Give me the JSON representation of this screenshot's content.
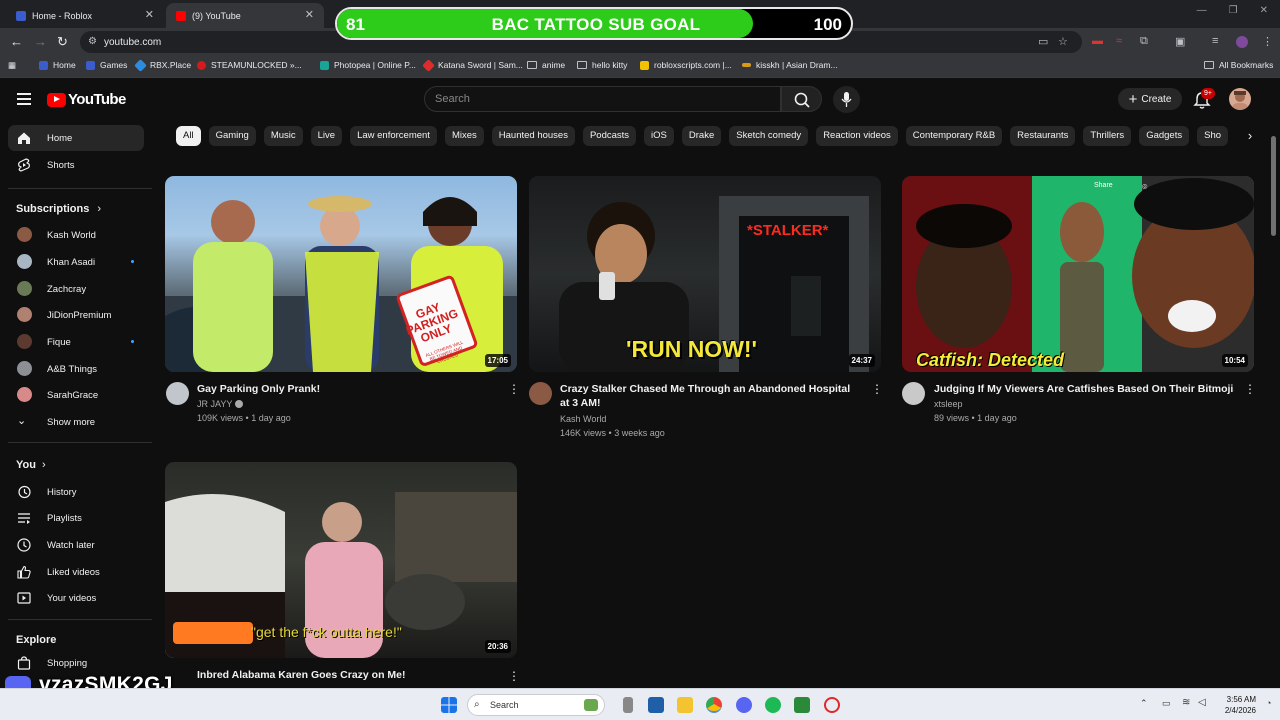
{
  "browser": {
    "tabs": [
      {
        "title": "Home - Roblox"
      },
      {
        "title": "(9) YouTube"
      }
    ],
    "url": "youtube.com",
    "bookmarks": [
      "Home",
      "Games",
      "RBX.Place",
      "STEAMUNLOCKED »...",
      "Photopea | Online P...",
      "Katana Sword | Sam...",
      "anime",
      "hello kitty",
      "robloxscripts.com |...",
      "kisskh | Asian Dram..."
    ],
    "all_bookmarks": "All Bookmarks"
  },
  "subgoal": {
    "current": "81",
    "title": "BAC TATTOO SUB GOAL",
    "goal": "100",
    "progress": 0.81
  },
  "youtube": {
    "logo_text": "YouTube",
    "search_placeholder": "Search",
    "create_label": "Create",
    "notif_badge": "9+",
    "chips": [
      "All",
      "Gaming",
      "Music",
      "Live",
      "Law enforcement",
      "Mixes",
      "Haunted houses",
      "Podcasts",
      "iOS",
      "Drake",
      "Sketch comedy",
      "Reaction videos",
      "Contemporary R&B",
      "Restaurants",
      "Thrillers",
      "Gadgets",
      "Sho"
    ],
    "sidebar": {
      "home": "Home",
      "shorts": "Shorts",
      "subscriptions_head": "Subscriptions",
      "subscriptions": [
        {
          "name": "Kash World",
          "dot": false
        },
        {
          "name": "Khan Asadi",
          "dot": true
        },
        {
          "name": "Zachcray",
          "dot": false
        },
        {
          "name": "JiDionPremium",
          "dot": false
        },
        {
          "name": "Fique",
          "dot": true
        },
        {
          "name": "A&B Things",
          "dot": false
        },
        {
          "name": "SarahGrace",
          "dot": false
        }
      ],
      "show_more": "Show more",
      "you_head": "You",
      "you_items": [
        "History",
        "Playlists",
        "Watch later",
        "Liked videos",
        "Your videos"
      ],
      "explore_head": "Explore",
      "explore_items": [
        "Shopping"
      ]
    },
    "videos": [
      {
        "title": "Gay Parking Only Prank!",
        "channel": "JR JAYY",
        "views": "109K views",
        "age": "1 day ago",
        "duration": "17:05",
        "overlay": "",
        "verified": true
      },
      {
        "title": "Crazy Stalker Chased Me Through an Abandoned Hospital at 3 AM!",
        "channel": "Kash World",
        "views": "146K views",
        "age": "3 weeks ago",
        "duration": "24:37",
        "overlay": "'RUN NOW!'",
        "overlay2": "*STALKER*",
        "verified": false
      },
      {
        "title": "Judging If My Viewers Are Catfishes Based On Their Bitmojis..",
        "channel": "xtsleep",
        "views": "89 views",
        "age": "1 day ago",
        "duration": "10:54",
        "overlay": "Catfish: Detected",
        "overlay2": "Share",
        "verified": false
      },
      {
        "title": "Inbred Alabama Karen Goes Crazy on Me!",
        "channel": "",
        "views": "",
        "age": "",
        "duration": "20:36",
        "overlay": "\"get the f*ck outta here!\"",
        "verified": false
      }
    ],
    "thumb1_sign": "GAY PARKING ONLY",
    "thumb1_sign_small": "ALL OTHERS WILL BE TOWED AND CRUSHED"
  },
  "overlay": {
    "discord_name": "vzazSMK2GJ"
  },
  "taskbar": {
    "search": "Search",
    "time": "3:56 AM",
    "date": "2/4/2026"
  }
}
